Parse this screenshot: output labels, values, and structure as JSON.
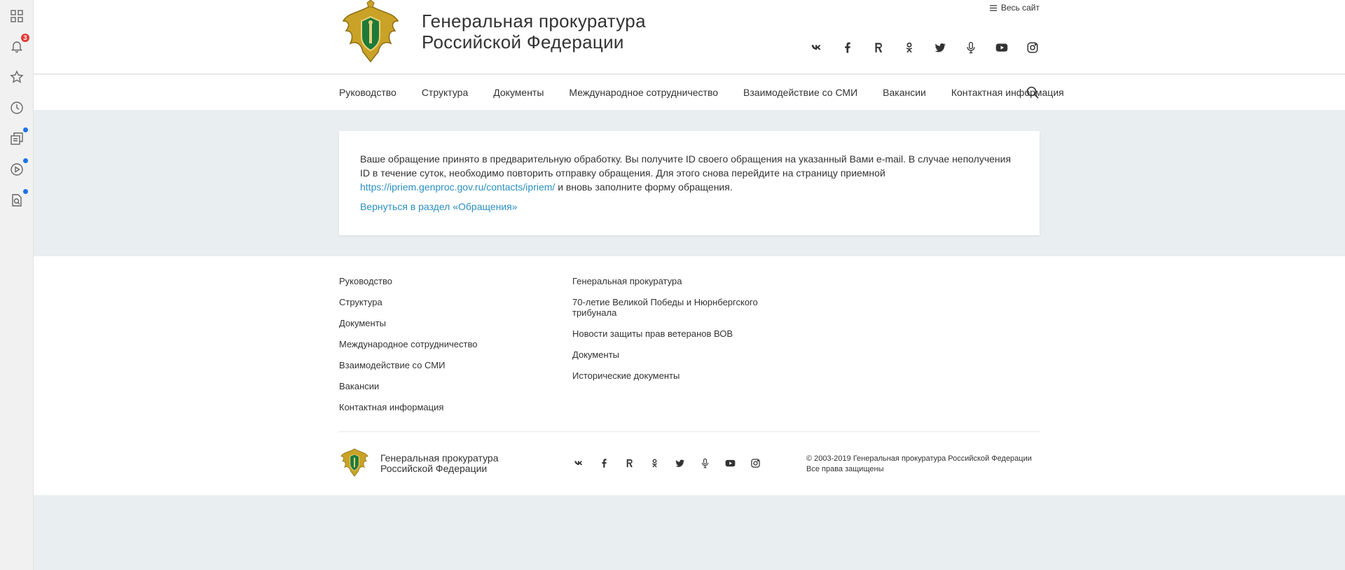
{
  "sidebar": {
    "notifications_count": "3",
    "items": [
      "apps-icon",
      "bell-icon",
      "star-icon",
      "clock-icon",
      "collections-icon",
      "play-icon",
      "search-doc-icon"
    ]
  },
  "header": {
    "title_line1": "Генеральная прокуратура",
    "title_line2": "Российской Федерации",
    "all_site": "Весь сайт",
    "socials": [
      "vk-icon",
      "facebook-icon",
      "rutube-icon",
      "odnoklassniki-icon",
      "twitter-icon",
      "podcast-icon",
      "youtube-icon",
      "instagram-icon"
    ]
  },
  "nav": {
    "items": [
      "Руководство",
      "Структура",
      "Документы",
      "Международное сотрудничество",
      "Взаимодействие со СМИ",
      "Вакансии",
      "Контактная информация"
    ]
  },
  "message": {
    "text_before_link": "Ваше обращение принято в предварительную обработку. Вы получите ID своего обращения на указанный Вами e-mail. В случае неполучения ID в течение суток, необходимо повторить отправку обращения. Для этого снова перейдите на страницу приемной ",
    "link": "https://ipriem.genproc.gov.ru/contacts/ipriem/",
    "text_after_link": " и вновь заполните форму обращения.",
    "back_link": "Вернуться в раздел «Обращения»"
  },
  "footer": {
    "col1": [
      "Руководство",
      "Структура",
      "Документы",
      "Международное сотрудничество",
      "Взаимодействие со СМИ",
      "Вакансии",
      "Контактная информация"
    ],
    "col2": [
      "Генеральная прокуратура",
      "70-летие Великой Победы и Нюрнбергского трибунала",
      "Новости защиты прав ветеранов ВОВ",
      "Документы",
      "Исторические документы"
    ],
    "title_line1": "Генеральная прокуратура",
    "title_line2": "Российской Федерации",
    "copyright_line1": "© 2003-2019 Генеральная прокуратура Российской Федерации",
    "copyright_line2": "Все права защищены"
  },
  "colors": {
    "accent_link": "#2a8fc1",
    "page_background": "#e9eef0",
    "badge": "#e53935",
    "dot": "#1a73e8"
  }
}
